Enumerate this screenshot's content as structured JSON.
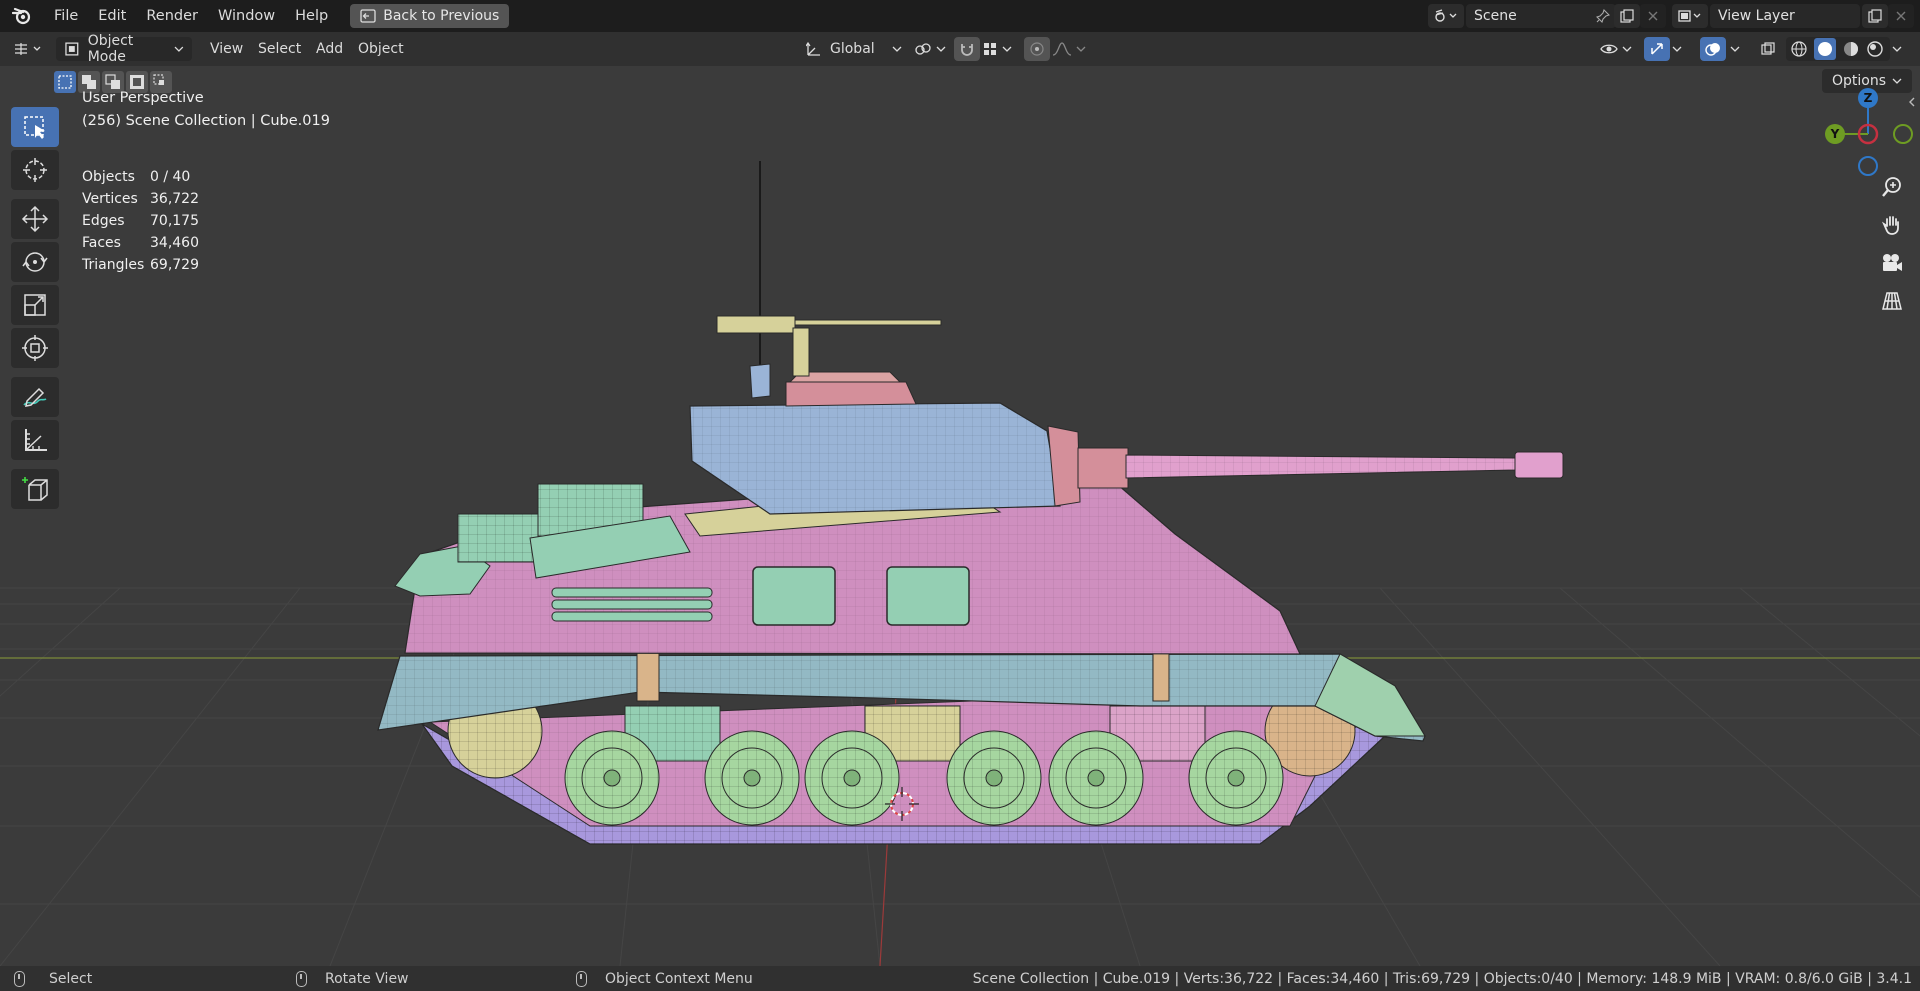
{
  "menu": {
    "items": [
      "File",
      "Edit",
      "Render",
      "Window",
      "Help"
    ],
    "back_label": "Back to Previous",
    "scene_label": "Scene",
    "view_layer_label": "View Layer"
  },
  "header": {
    "mode_label": "Object Mode",
    "view_label": "View",
    "select_label": "Select",
    "add_label": "Add",
    "object_label": "Object",
    "orientation_label": "Global",
    "options_label": "Options"
  },
  "viewport": {
    "perspective_label": "User Perspective",
    "collection_label": "(256) Scene Collection | Cube.019",
    "stats": [
      {
        "key": "Objects",
        "value": "0 / 40"
      },
      {
        "key": "Vertices",
        "value": "36,722"
      },
      {
        "key": "Edges",
        "value": "70,175"
      },
      {
        "key": "Faces",
        "value": "34,460"
      },
      {
        "key": "Triangles",
        "value": "69,729"
      }
    ],
    "gizmo": {
      "z": "Z",
      "y": "Y"
    }
  },
  "statusbar": {
    "select_label": "Select",
    "rotate_label": "Rotate View",
    "context_label": "Object Context Menu",
    "info": "Scene Collection | Cube.019 | Verts:36,722 | Faces:34,460 | Tris:69,729 | Objects:0/40 | Memory: 148.9 MiB | VRAM: 0.8/6.0 GiB | 3.4.1"
  },
  "colors": {
    "accent": "#4772b3",
    "viewport_bg": "#3b3b3b",
    "hull_pink": "#cf8fbf",
    "skirt_blue": "#93b9c4",
    "turret_blue": "#9ab4d6",
    "wheel_green": "#a6d6a0",
    "track_purple": "#a898dd",
    "stowage_green": "#94cfb3",
    "deck_yellow": "#d6d19a",
    "gizmo_x": "#c63040",
    "gizmo_y": "#6e9c23",
    "gizmo_z": "#2f78c8"
  }
}
